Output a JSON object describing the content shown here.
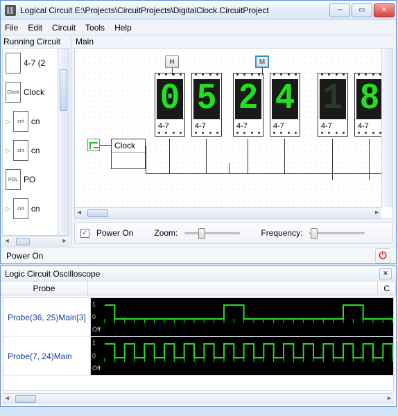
{
  "window": {
    "title": "Logical Circuit E:\\Projects\\CircuitProjects\\DigitalClock.CircuitProject"
  },
  "menu": {
    "file": "File",
    "edit": "Edit",
    "circuit": "Circuit",
    "tools": "Tools",
    "help": "Help"
  },
  "sidebar": {
    "title": "Running Circuit",
    "items": [
      {
        "label": "4-7 (2",
        "chip": ""
      },
      {
        "label": "Clock",
        "chip": "Clock"
      },
      {
        "label": "cn",
        "chip": "cnt"
      },
      {
        "label": "cn",
        "chip": "cnt"
      },
      {
        "label": "PO",
        "chip": "POL"
      },
      {
        "label": "cn",
        "chip": "cnt"
      }
    ]
  },
  "canvas": {
    "title": "Main",
    "buttons": {
      "h": "H",
      "m": "M"
    },
    "digits": [
      "0",
      "5",
      "2",
      "4",
      "1",
      "8"
    ],
    "module_label": "4-7",
    "clock_label": "Clock"
  },
  "controls": {
    "power_on": "Power On",
    "power_checked": true,
    "zoom": "Zoom:",
    "frequency": "Frequency:"
  },
  "status": {
    "text": "Power On"
  },
  "oscilloscope": {
    "title": "Logic Circuit Oscilloscope",
    "col_probe": "Probe",
    "col_c": "C",
    "probes": [
      {
        "name": "Probe(36, 25)Main[3]"
      },
      {
        "name": "Probe(7, 24)Main"
      }
    ],
    "axis": {
      "one": "1",
      "zero": "0",
      "off": "Off"
    }
  },
  "chart_data": [
    {
      "type": "line",
      "title": "Probe(36, 25)Main[3]",
      "ylabel": "",
      "xlabel": "",
      "y_levels": [
        "Off",
        "0",
        "1"
      ],
      "values": [
        1,
        0,
        0,
        0,
        0,
        0,
        0,
        0,
        0,
        0,
        0,
        0,
        1,
        1,
        0,
        0,
        0,
        0,
        0,
        0,
        0,
        0,
        0,
        0,
        1,
        1,
        0,
        0,
        0,
        0
      ]
    },
    {
      "type": "line",
      "title": "Probe(7, 24)Main",
      "ylabel": "",
      "xlabel": "",
      "y_levels": [
        "Off",
        "0",
        "1"
      ],
      "values": [
        1,
        0,
        1,
        0,
        1,
        0,
        1,
        0,
        1,
        0,
        1,
        0,
        1,
        0,
        1,
        0,
        1,
        0,
        1,
        0,
        1,
        0,
        1,
        0,
        1,
        0,
        1,
        0,
        1,
        0
      ]
    }
  ]
}
